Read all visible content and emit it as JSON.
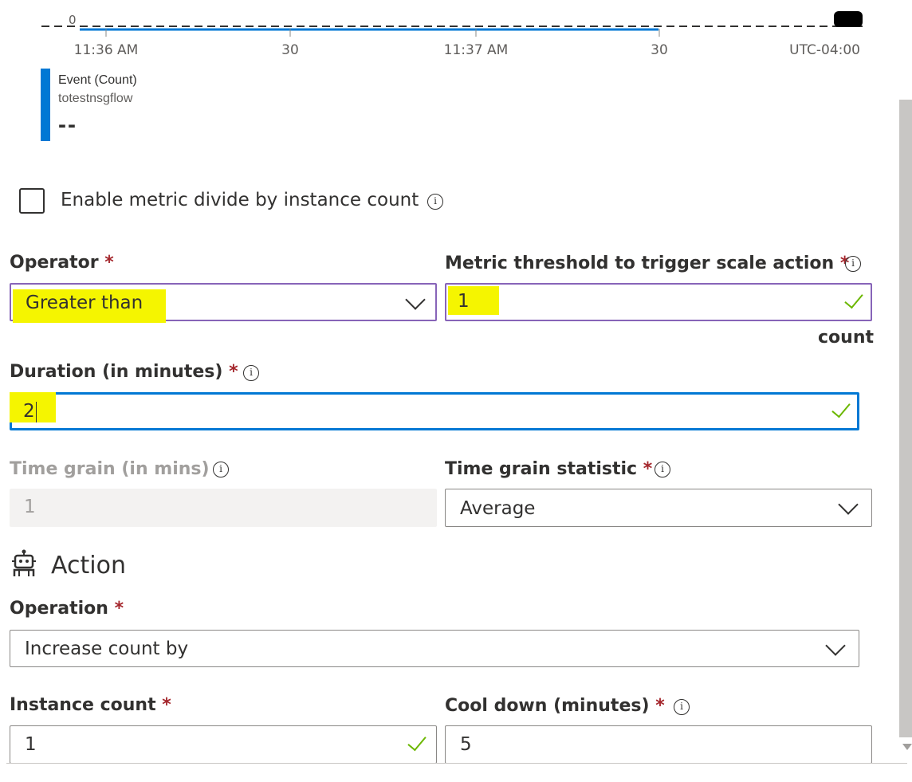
{
  "chart_data": {
    "type": "line",
    "y_tick": "0",
    "x_ticks": [
      "11:36 AM",
      "30",
      "11:37 AM",
      "30"
    ],
    "timezone": "UTC-04:00",
    "series": [
      {
        "name": "Event (Count)",
        "resource": "totestnsgflow",
        "value": "--",
        "color": "#0078d4"
      }
    ]
  },
  "checkbox": {
    "label": "Enable metric divide by instance count",
    "checked": false
  },
  "operator": {
    "label": "Operator",
    "required": "*",
    "value": "Greater than"
  },
  "threshold": {
    "label": "Metric threshold to trigger scale action",
    "required": "*",
    "value": "1",
    "unit": "count"
  },
  "duration": {
    "label": "Duration (in minutes)",
    "required": "*",
    "value": "2"
  },
  "time_grain": {
    "label": "Time grain (in mins)",
    "value": "1"
  },
  "time_grain_statistic": {
    "label": "Time grain statistic",
    "required": "*",
    "value": "Average"
  },
  "action": {
    "title": "Action"
  },
  "operation": {
    "label": "Operation",
    "required": "*",
    "value": "Increase count by"
  },
  "instance_count": {
    "label": "Instance count",
    "required": "*",
    "value": "1"
  },
  "cool_down": {
    "label": "Cool down (minutes)",
    "required": "*",
    "value": "5"
  },
  "info_glyph": "i",
  "colors": {
    "accent": "#0078d4",
    "highlight": "#f5f500",
    "required": "#a4262c",
    "valid": "#6bb700",
    "hover_border": "#8764b8"
  }
}
